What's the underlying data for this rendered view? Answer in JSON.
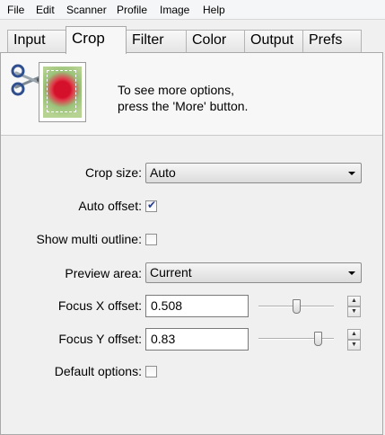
{
  "menu": [
    "File",
    "Edit",
    "Scanner",
    "Profile",
    "Image",
    "Help"
  ],
  "tabs": [
    "Input",
    "Crop",
    "Filter",
    "Color",
    "Output",
    "Prefs"
  ],
  "active_tab": "Crop",
  "info": {
    "line1": "To see more options,",
    "line2": "press the 'More' button."
  },
  "form": {
    "crop_size_label": "Crop size:",
    "crop_size_value": "Auto",
    "auto_offset_label": "Auto offset:",
    "auto_offset_checked": true,
    "show_multi_outline_label": "Show multi outline:",
    "show_multi_outline_checked": false,
    "preview_area_label": "Preview area:",
    "preview_area_value": "Current",
    "focus_x_label": "Focus X offset:",
    "focus_x_value": "0.508",
    "focus_x_slider": 0.508,
    "focus_y_label": "Focus Y offset:",
    "focus_y_value": "0.83",
    "focus_y_slider": 0.83,
    "default_options_label": "Default options:",
    "default_options_checked": false
  },
  "icons": {
    "scissors": "scissors-icon",
    "thumbnail": "crop-preview-thumbnail",
    "dropdown": "chevron-down-icon",
    "spin_up": "spin-up-icon",
    "spin_down": "spin-down-icon",
    "check": "checkmark-icon"
  }
}
